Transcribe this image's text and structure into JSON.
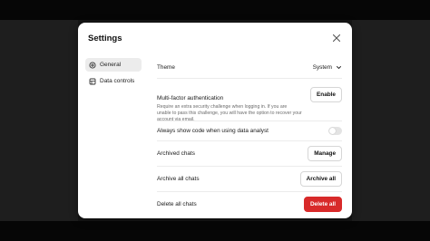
{
  "dialog": {
    "title": "Settings"
  },
  "sidebar": {
    "items": [
      {
        "label": "General",
        "icon": "gear-icon",
        "active": true
      },
      {
        "label": "Data controls",
        "icon": "database-icon",
        "active": false
      }
    ]
  },
  "settings": {
    "theme": {
      "label": "Theme",
      "value": "System"
    },
    "mfa": {
      "label": "Multi-factor authentication",
      "description": "Require an extra security challenge when logging in. If you are unable to pass this challenge, you will have the option to recover your account via email.",
      "button": "Enable"
    },
    "code_analyst": {
      "label": "Always show code when using data analyst",
      "enabled": false
    },
    "archived_chats": {
      "label": "Archived chats",
      "button": "Manage"
    },
    "archive_all": {
      "label": "Archive all chats",
      "button": "Archive all"
    },
    "delete_all": {
      "label": "Delete all chats",
      "button": "Delete all"
    }
  },
  "colors": {
    "danger": "#d82a2a",
    "active_nav_bg": "#ececec",
    "toggle_off": "#e3e3e3"
  }
}
